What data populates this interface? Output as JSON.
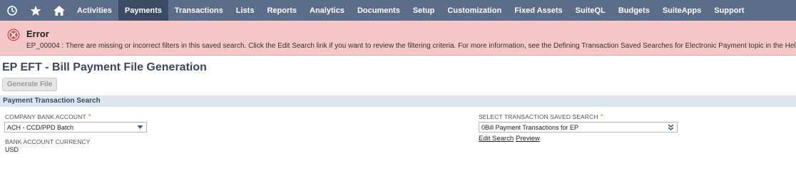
{
  "nav": {
    "icons": [
      "recent-icon",
      "star-icon",
      "home-icon"
    ],
    "items": [
      {
        "label": "Activities"
      },
      {
        "label": "Payments",
        "active": true
      },
      {
        "label": "Transactions"
      },
      {
        "label": "Lists"
      },
      {
        "label": "Reports"
      },
      {
        "label": "Analytics"
      },
      {
        "label": "Documents"
      },
      {
        "label": "Setup"
      },
      {
        "label": "Customization"
      },
      {
        "label": "Fixed Assets"
      },
      {
        "label": "SuiteQL"
      },
      {
        "label": "Budgets"
      },
      {
        "label": "SuiteApps"
      },
      {
        "label": "Support"
      }
    ]
  },
  "error": {
    "title": "Error",
    "message": "EP_00004 : There are missing or incorrect filters in this saved search. Click the Edit Search link if you want to review the filtering criteria. For more information, see the Defining Transaction Saved Searches for Electronic Payment topic in the Help Cente"
  },
  "page": {
    "title": "EP EFT - Bill Payment File Generation",
    "generate_button": "Generate File"
  },
  "section": {
    "title": "Payment Transaction Search"
  },
  "fields": {
    "company_bank_account": {
      "label": "COMPANY BANK ACCOUNT",
      "required": "*",
      "value": "ACH - CCD/PPD Batch"
    },
    "bank_account_currency": {
      "label": "BANK ACCOUNT CURRENCY",
      "value": "USD"
    },
    "saved_search": {
      "label": "SELECT TRANSACTION SAVED SEARCH",
      "required": "*",
      "value": "0Bill Payment Transactions for EP"
    }
  },
  "links": {
    "edit_search": "Edit Search",
    "preview": "Preview"
  },
  "colors": {
    "nav_bg": "#5c6d8a",
    "nav_active": "#3d4a63",
    "error_bg": "#f5c7c7",
    "error_icon": "#d9534f",
    "title": "#384a62",
    "required": "#e89a2a"
  }
}
